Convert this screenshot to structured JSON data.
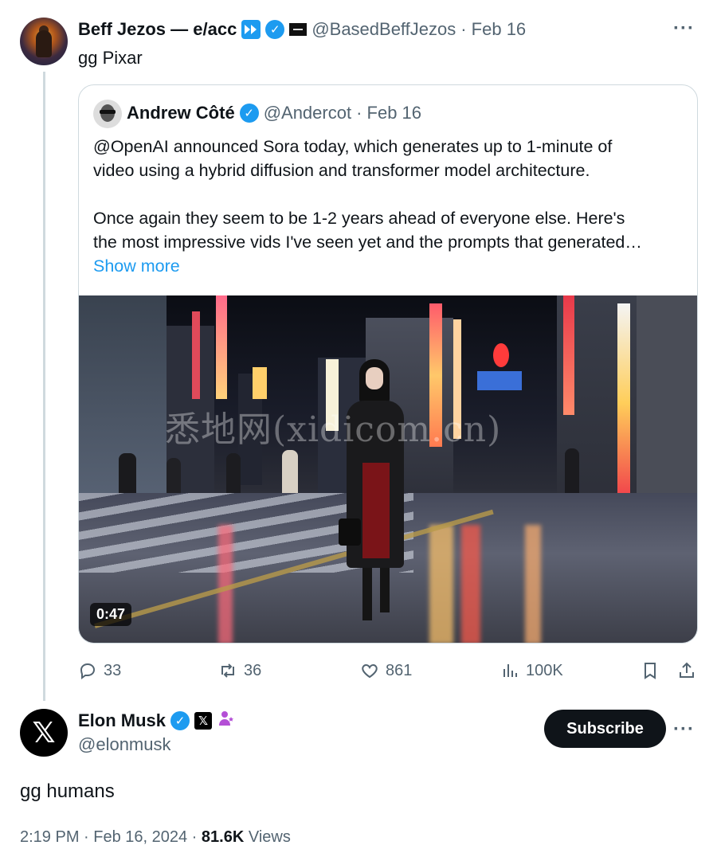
{
  "top_tweet": {
    "display_name": "Beff Jezos — e/acc",
    "handle": "@BasedBeffJezos",
    "date": "· Feb 16",
    "text": "gg Pixar",
    "more": "···"
  },
  "quoted_tweet": {
    "display_name": "Andrew Côté",
    "handle": "@Andercot",
    "date": "· Feb 16",
    "lines": [
      "@OpenAI announced Sora today, which generates up to 1-minute of",
      "video using a hybrid diffusion and transformer model architecture.",
      "Once again they seem to be 1-2 years ahead of everyone else. Here's",
      "the most impressive vids I've seen yet and the prompts that generated…"
    ],
    "show_more": "Show more",
    "video": {
      "duration": "0:47",
      "watermark": "悉地网(xidicom.cn)"
    }
  },
  "actions": {
    "replies": "33",
    "reposts": "36",
    "likes": "861",
    "views": "100K"
  },
  "main_tweet": {
    "display_name": "Elon Musk",
    "handle": "@elonmusk",
    "subscribe_label": "Subscribe",
    "more": "···",
    "text": "gg humans",
    "time": "2:19 PM · Feb 16, 2024 ·",
    "views_count": "81.6K",
    "views_label": "Views"
  },
  "colors": {
    "accent": "#1d9bf0",
    "muted": "#536471",
    "text": "#0f1419",
    "border": "#cfd9de"
  }
}
